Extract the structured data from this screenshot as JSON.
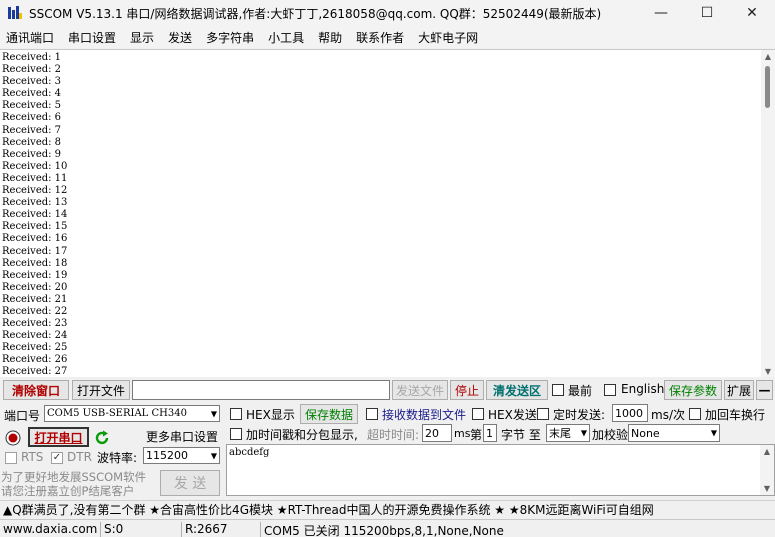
{
  "window": {
    "title": "SSCOM V5.13.1 串口/网络数据调试器,作者:大虾丁丁,2618058@qq.com. QQ群：52502449(最新版本)",
    "minimize": "—",
    "maximize": "☐",
    "close": "✕"
  },
  "menu": {
    "items": [
      "通讯端口",
      "串口设置",
      "显示",
      "发送",
      "多字符串",
      "小工具",
      "帮助",
      "联系作者",
      "大虾电子网"
    ]
  },
  "receive": {
    "lines": [
      "Received: 1",
      "Received: 2",
      "Received: 3",
      "Received: 4",
      "Received: 5",
      "Received: 6",
      "Received: 7",
      "Received: 8",
      "Received: 9",
      "Received: 10",
      "Received: 11",
      "Received: 12",
      "Received: 13",
      "Received: 14",
      "Received: 15",
      "Received: 16",
      "Received: 17",
      "Received: 18",
      "Received: 19",
      "Received: 20",
      "Received: 21",
      "Received: 22",
      "Received: 23",
      "Received: 24",
      "Received: 25",
      "Received: 26",
      "Received: 27"
    ]
  },
  "toolbar": {
    "clear_window": "清除窗口",
    "open_file": "打开文件",
    "file_path": "",
    "send_file": "发送文件",
    "stop": "停止",
    "clear_send": "清发送区",
    "topmost": "最前",
    "english": "English",
    "save_params": "保存参数",
    "expand": "扩展",
    "collapse": "—"
  },
  "left": {
    "port_label": "端口号",
    "port_value": "COM5 USB-SERIAL CH340",
    "open_port": "打开串口",
    "more_settings": "更多串口设置",
    "rts": "RTS",
    "dtr": "DTR",
    "baud_label": "波特率:",
    "baud_value": "115200",
    "promo_line1": "为了更好地发展SSCOM软件",
    "promo_line2": "请您注册嘉立创P结尾客户",
    "send_button": "发 送"
  },
  "right": {
    "hex_display": "HEX显示",
    "save_data": "保存数据",
    "recv_to_file": "接收数据到文件",
    "hex_send": "HEX发送",
    "timed_send": "定时发送:",
    "interval_value": "1000",
    "interval_unit": "ms/次",
    "add_crlf": "加回车换行",
    "timestamp": "加时间戳和分包显示,",
    "timeout_label": "超时时间:",
    "timeout_value": "20",
    "timeout_unit": "ms",
    "byte_index_label": "第",
    "byte_index_value": "1",
    "byte_label": "字节 至",
    "end_value": "末尾",
    "checksum_label": "加校验",
    "checksum_value": "None",
    "send_text": "abcdefg"
  },
  "adbar": {
    "text": "▲Q群满员了,没有第二个群  ★合宙高性价比4G模块  ★RT-Thread中国人的开源免费操作系统  ★  ★8KM远距离WiFi可自组网"
  },
  "status": {
    "website": "www.daxia.com",
    "sent": "S:0",
    "received": "R:2667",
    "port_status": "COM5 已关闭  115200bps,8,1,None,None"
  },
  "colors": {
    "red_text": "#b00000",
    "green_text": "#008000",
    "teal_text": "#007070"
  }
}
